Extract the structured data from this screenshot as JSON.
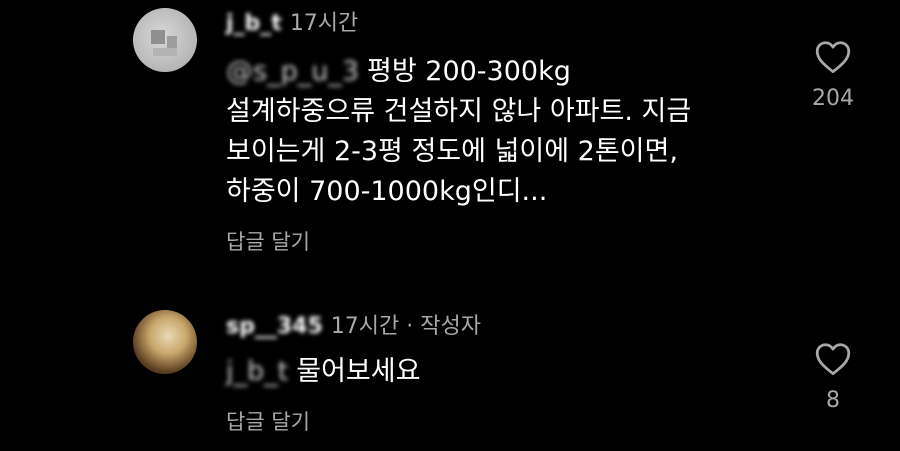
{
  "comments": [
    {
      "username": "j_b_t",
      "time": "17시간",
      "mention": "@s_p_u_3",
      "lines": [
        "평방 200-300kg",
        "설계하중으류 건설하지 않나 아파트. 지금",
        "보이는게 2-3평 정도에 넓이에 2톤이면,",
        "하중이 700-1000kg인디..."
      ],
      "reply_label": "답글 달기",
      "like_count": "204"
    },
    {
      "username": "sp__345",
      "time": "17시간",
      "separator": "·",
      "author_badge": "작성자",
      "mention": "j_b_t",
      "lines": [
        "물어보세요"
      ],
      "reply_label": "답글 달기",
      "like_count": "8"
    }
  ],
  "icons": {
    "like": "heart-outline-icon"
  },
  "colors": {
    "background": "#000000",
    "primary_text": "#ffffff",
    "secondary_text": "#a8a8a8"
  }
}
